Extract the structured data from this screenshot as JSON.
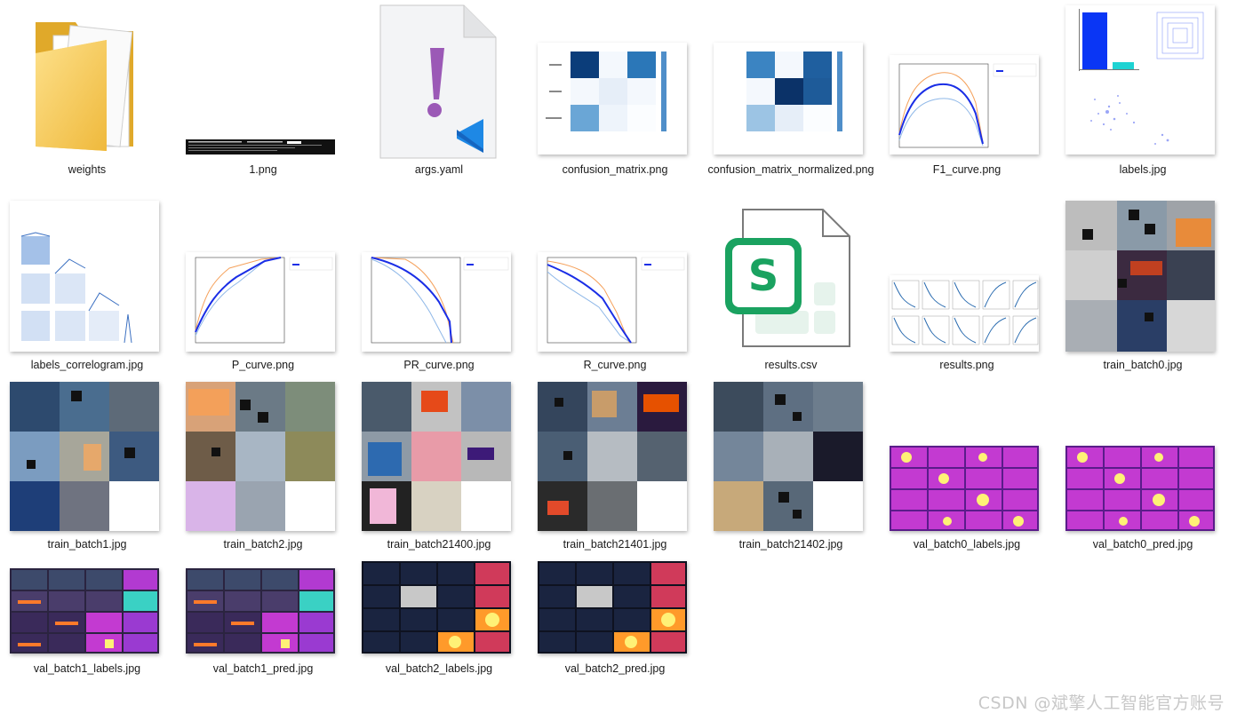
{
  "files": [
    {
      "name": "weights",
      "kind": "folder",
      "icon": "folder-icon"
    },
    {
      "name": "1.png",
      "kind": "image",
      "icon": "terminal-screenshot-thumbnail"
    },
    {
      "name": "args.yaml",
      "kind": "yaml",
      "icon": "vscode-yaml-file-icon"
    },
    {
      "name": "confusion_matrix.png",
      "kind": "image",
      "icon": "confusion-matrix-thumbnail"
    },
    {
      "name": "confusion_matrix_normalized.png",
      "kind": "image",
      "icon": "confusion-matrix-normalized-thumbnail"
    },
    {
      "name": "F1_curve.png",
      "kind": "image",
      "icon": "f1-curve-thumbnail"
    },
    {
      "name": "labels.jpg",
      "kind": "image",
      "icon": "labels-thumbnail"
    },
    {
      "name": "labels_correlogram.jpg",
      "kind": "image",
      "icon": "correlogram-thumbnail"
    },
    {
      "name": "P_curve.png",
      "kind": "image",
      "icon": "p-curve-thumbnail"
    },
    {
      "name": "PR_curve.png",
      "kind": "image",
      "icon": "pr-curve-thumbnail"
    },
    {
      "name": "R_curve.png",
      "kind": "image",
      "icon": "r-curve-thumbnail"
    },
    {
      "name": "results.csv",
      "kind": "csv",
      "icon": "wps-spreadsheet-file-icon"
    },
    {
      "name": "results.png",
      "kind": "image",
      "icon": "results-plots-thumbnail"
    },
    {
      "name": "train_batch0.jpg",
      "kind": "image",
      "icon": "train-batch-thumbnail"
    },
    {
      "name": "train_batch1.jpg",
      "kind": "image",
      "icon": "train-batch-thumbnail"
    },
    {
      "name": "train_batch2.jpg",
      "kind": "image",
      "icon": "train-batch-thumbnail"
    },
    {
      "name": "train_batch21400.jpg",
      "kind": "image",
      "icon": "train-batch-thumbnail"
    },
    {
      "name": "train_batch21401.jpg",
      "kind": "image",
      "icon": "train-batch-thumbnail"
    },
    {
      "name": "train_batch21402.jpg",
      "kind": "image",
      "icon": "train-batch-thumbnail"
    },
    {
      "name": "val_batch0_labels.jpg",
      "kind": "image",
      "icon": "val-batch-thumbnail"
    },
    {
      "name": "val_batch0_pred.jpg",
      "kind": "image",
      "icon": "val-batch-thumbnail"
    },
    {
      "name": "val_batch1_labels.jpg",
      "kind": "image",
      "icon": "val-batch-thumbnail"
    },
    {
      "name": "val_batch1_pred.jpg",
      "kind": "image",
      "icon": "val-batch-thumbnail"
    },
    {
      "name": "val_batch2_labels.jpg",
      "kind": "image",
      "icon": "val-batch-thumbnail"
    },
    {
      "name": "val_batch2_pred.jpg",
      "kind": "image",
      "icon": "val-batch-thumbnail"
    }
  ],
  "watermark": "CSDN @斌擎人工智能官方账号",
  "colors": {
    "folder": "#f4c542",
    "yaml_mark": "#9b59b6",
    "vscode": "#1e88e5",
    "sheet": "#1aa260",
    "thermal_a": "#6a1b9a",
    "thermal_b": "#e040fb",
    "thermal_c": "#ffeb3b"
  }
}
